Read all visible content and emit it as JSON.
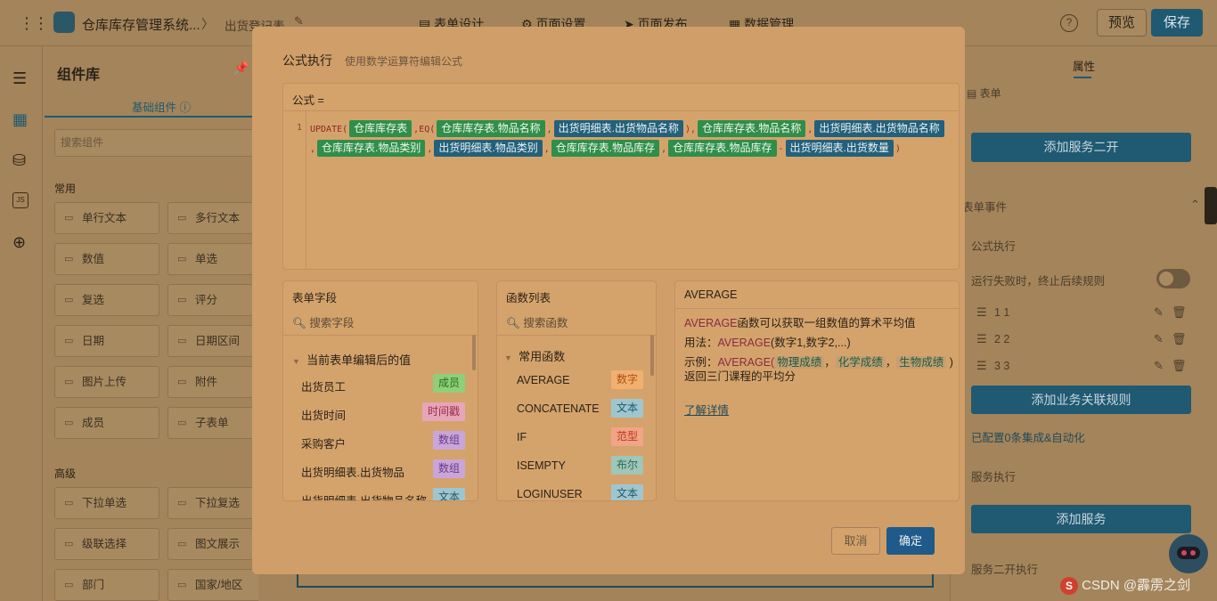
{
  "header": {
    "app_title": "仓库库存管理系统...",
    "breadcrumb_sep": "〉",
    "form_name": "出货登记表",
    "tabs": [
      "表单设计",
      "页面设置",
      "页面发布",
      "数据管理"
    ],
    "preview_label": "预览",
    "save_label": "保存",
    "help_glyph": "?"
  },
  "library": {
    "title": "组件库",
    "tab_basic": "基础组件",
    "search_placeholder": "搜索组件",
    "group_common": "常用",
    "group_advanced": "高级",
    "common_items": [
      "单行文本",
      "多行文本",
      "数值",
      "单选",
      "复选",
      "评分",
      "日期",
      "日期区间",
      "图片上传",
      "附件",
      "成员",
      "子表单"
    ],
    "advanced_items": [
      "下拉单选",
      "下拉复选",
      "级联选择",
      "图文展示",
      "部门",
      "国家/地区"
    ]
  },
  "right_panel": {
    "tab_props": "属性",
    "form_label": "表单",
    "add_service_dev": "添加服务二开",
    "form_events": "表单事件",
    "formula_exec": "公式执行",
    "fail_stop": "运行失败时，终止后续规则",
    "rules": [
      "1 1",
      "2 2",
      "3 3"
    ],
    "add_business_rule": "添加业务关联规则",
    "configured_text": "已配置0条集成&自动化",
    "service_exec": "服务执行",
    "add_service": "添加服务",
    "service_dev_exec": "服务二开执行"
  },
  "dialog": {
    "title": "公式执行",
    "subtitle": "使用数学运算符编辑公式",
    "formula_label": "公式 =",
    "line_number": "1",
    "formula_fn_update": "UPDATE(",
    "formula_chips": [
      {
        "text": "仓库库存表",
        "kind": "green"
      },
      {
        "sep": ",EQ("
      },
      {
        "text": "仓库库存表.物品名称",
        "kind": "green"
      },
      {
        "sep": ","
      },
      {
        "text": "出货明细表.出货物品名称",
        "kind": "blue"
      },
      {
        "sep": "),"
      },
      {
        "text": "仓库库存表.物品名称",
        "kind": "green"
      },
      {
        "sep": ","
      },
      {
        "text": "出货明细表.出货物品名称",
        "kind": "blue"
      }
    ],
    "formula_line2": [
      {
        "sep": ","
      },
      {
        "text": "仓库库存表.物品类别",
        "kind": "green"
      },
      {
        "sep": ","
      },
      {
        "text": "出货明细表.物品类别",
        "kind": "blue"
      },
      {
        "sep": ","
      },
      {
        "text": "仓库库存表.物品库存",
        "kind": "green"
      },
      {
        "sep": ","
      },
      {
        "text": "仓库库存表.物品库存",
        "kind": "green"
      },
      {
        "sep": "-"
      },
      {
        "text": "出货明细表.出货数量",
        "kind": "blue"
      },
      {
        "sep": ")"
      }
    ],
    "fields_title": "表单字段",
    "fields_search": "搜索字段",
    "fields_group": "当前表单编辑后的值",
    "fields": [
      {
        "name": "出货员工",
        "type": "成员"
      },
      {
        "name": "出货时间",
        "type": "时间戳"
      },
      {
        "name": "采购客户",
        "type": "数组"
      },
      {
        "name": "出货明细表.出货物品",
        "type": "数组"
      },
      {
        "name": "出货明细表.出货物品名称",
        "type": "文本"
      }
    ],
    "funcs_title": "函数列表",
    "funcs_search": "搜索函数",
    "funcs_group": "常用函数",
    "funcs": [
      {
        "name": "AVERAGE",
        "type": "数字"
      },
      {
        "name": "CONCATENATE",
        "type": "文本"
      },
      {
        "name": "IF",
        "type": "范型"
      },
      {
        "name": "ISEMPTY",
        "type": "布尔"
      },
      {
        "name": "LOGINUSER",
        "type": "文本"
      }
    ],
    "help_title": "AVERAGE",
    "help_desc_fn": "AVERAGE",
    "help_desc": "函数可以获取一组数值的算术平均值",
    "help_usage_label": "用法：",
    "help_usage_fn": "AVERAGE",
    "help_usage_args": "(数字1,数字2,...)",
    "help_example_label": "示例：",
    "help_example_fn": "AVERAGE(",
    "help_example_args": [
      "物理成绩",
      "化学成绩",
      "生物成绩"
    ],
    "help_example_close": ")",
    "help_example_result": "返回三门课程的平均分",
    "help_more": "了解详情",
    "cancel_label": "取消",
    "ok_label": "确定"
  },
  "watermark": "CSDN @霹雳之剑"
}
